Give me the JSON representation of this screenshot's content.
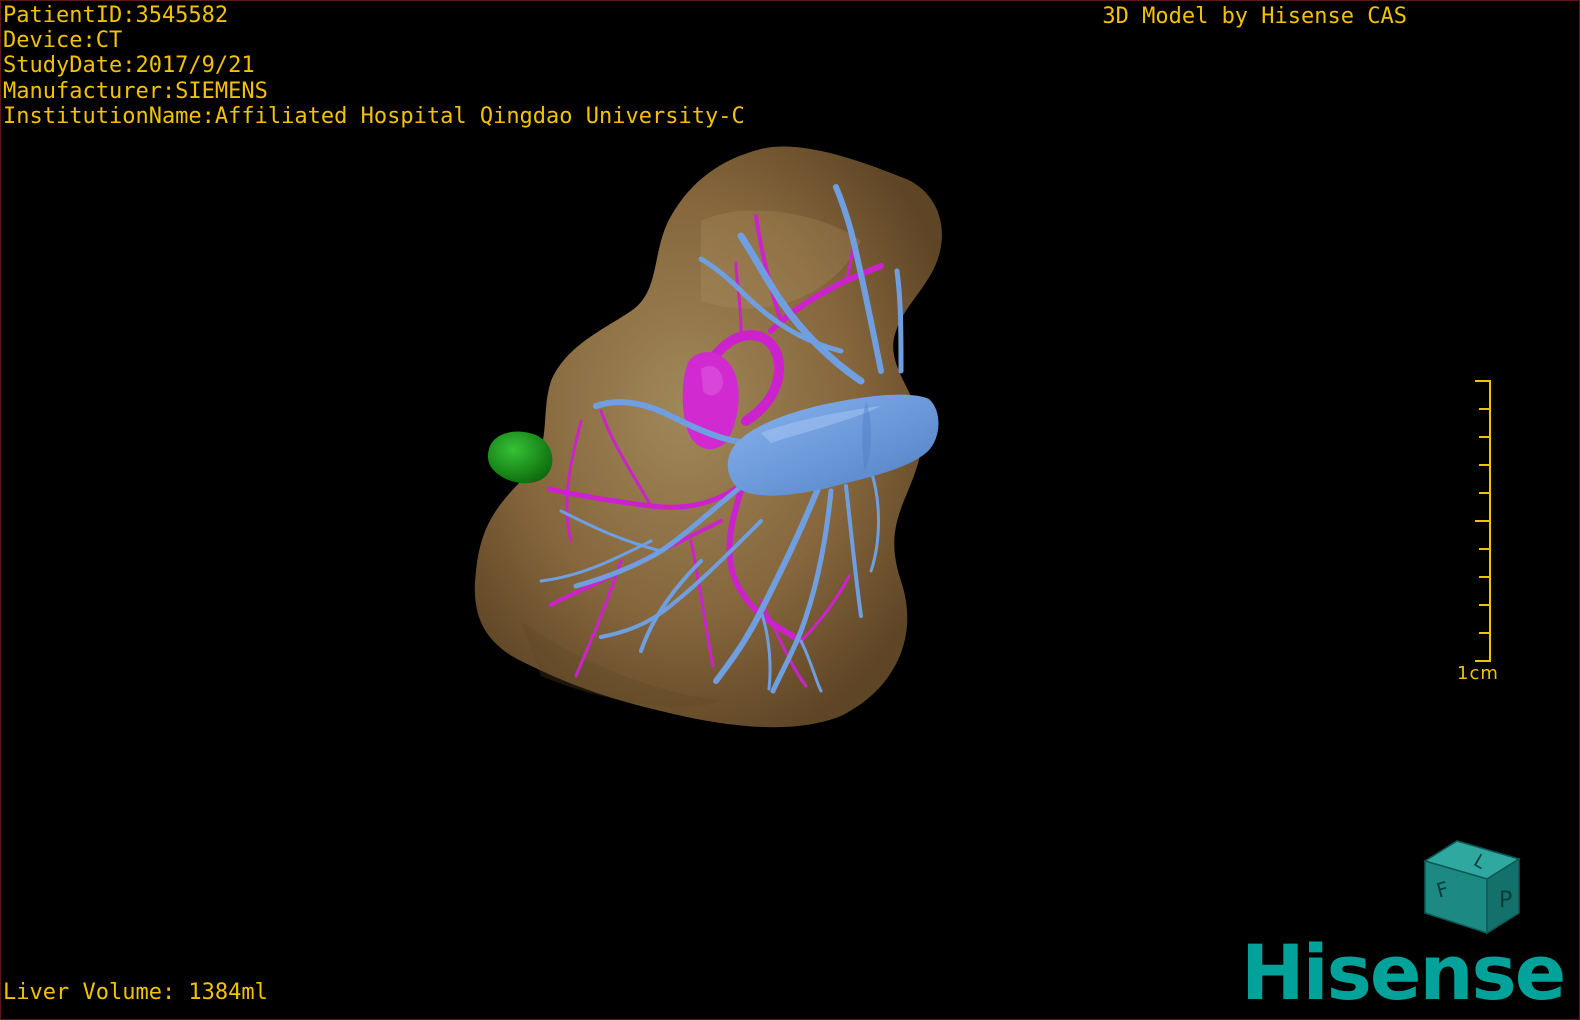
{
  "patient": {
    "patient_id": "PatientID:3545582",
    "device": "Device:CT",
    "study_date": "StudyDate:2017/9/21",
    "manufacturer": "Manufacturer:SIEMENS",
    "institution": "InstitutionName:Affiliated Hospital Qingdao University-C"
  },
  "credit": "3D Model by Hisense CAS",
  "liver_volume": "Liver Volume: 1384ml",
  "scale_bar": {
    "label": "1cm"
  },
  "orientation_cube": {
    "face_front": "P",
    "face_left": "F",
    "face_top": "L"
  },
  "brand": "Hisense",
  "colors": {
    "overlay_text": "#f2c200",
    "liver": "#8a6a40",
    "portal_vein": "#6f9fe0",
    "hepatic_artery": "#cc22cc",
    "lesion": "#1a9a1a",
    "brand": "#00a29a"
  }
}
